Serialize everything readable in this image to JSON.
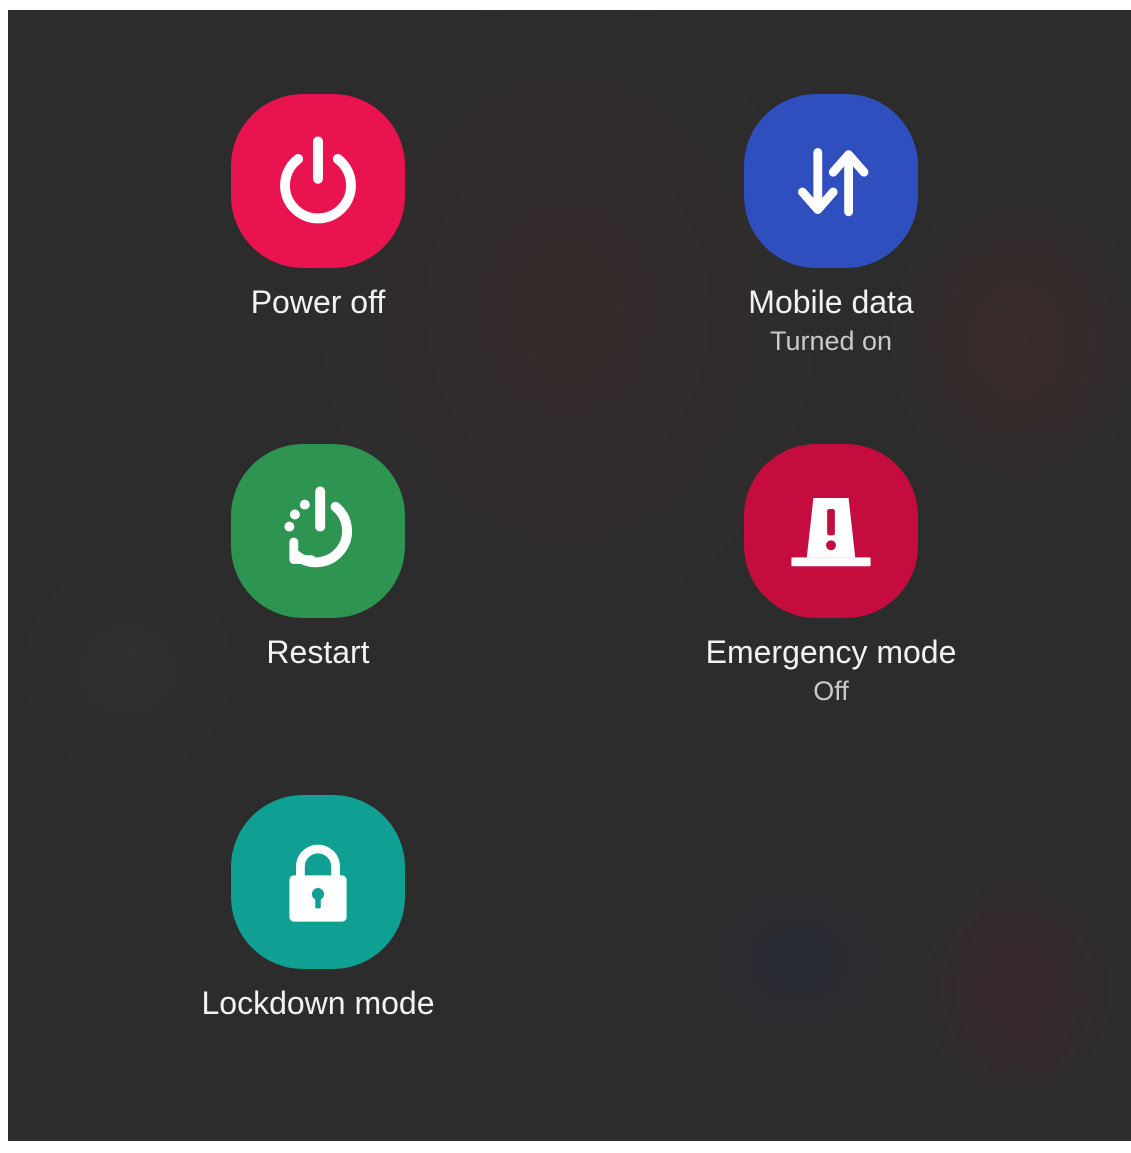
{
  "colors": {
    "background": "#2c2c2c",
    "power_off": "#e8134f",
    "mobile_data": "#2f4fbf",
    "restart": "#2e9451",
    "emergency": "#c40d3e",
    "lockdown": "#0fa093",
    "label_text": "#f2f2f2",
    "sublabel_text": "#c9c9c9"
  },
  "actions": {
    "power_off": {
      "label": "Power off",
      "icon": "power-icon"
    },
    "mobile_data": {
      "label": "Mobile data",
      "status": "Turned on",
      "icon": "data-transfer-icon"
    },
    "restart": {
      "label": "Restart",
      "icon": "restart-icon"
    },
    "emergency_mode": {
      "label": "Emergency mode",
      "status": "Off",
      "icon": "siren-icon"
    },
    "lockdown_mode": {
      "label": "Lockdown mode",
      "icon": "lock-icon"
    }
  }
}
